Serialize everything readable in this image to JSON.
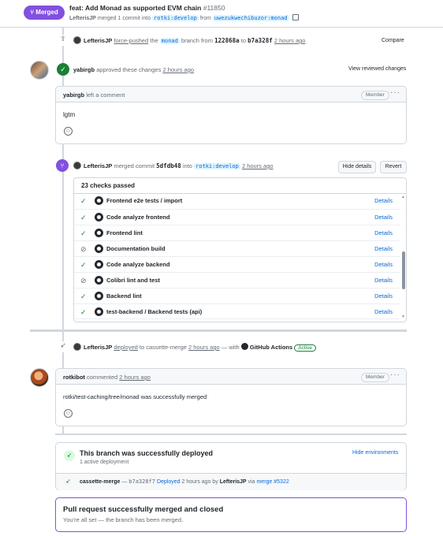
{
  "header": {
    "merged_badge": "Merged",
    "title": "feat: Add Monad as supported EVM chain",
    "number": "#11850",
    "author": "LefterisJP",
    "merge_text": "merged 1 commit into",
    "base_branch": "rotki:develop",
    "from_text": "from",
    "head_branch": "uwezukwechibuzor:monad"
  },
  "force_push": {
    "author": "LefterisJP",
    "action": "force-pushed",
    "the": "the",
    "branch": "monad",
    "branch_from": "branch from",
    "from_sha": "122868a",
    "to": "to",
    "to_sha": "b7a328f",
    "time": "2 hours ago",
    "compare": "Compare"
  },
  "approval": {
    "user": "yabirgb",
    "text": "approved these changes",
    "time": "2 hours ago",
    "view_changes": "View reviewed changes"
  },
  "comment1": {
    "user": "yabirgb",
    "action": "left a comment",
    "role": "Member",
    "body": "lgtm",
    "menu": "···"
  },
  "merge_event": {
    "author": "LefterisJP",
    "text": "merged commit",
    "sha": "5dfdb48",
    "into": "into",
    "branch": "rotki:develop",
    "time": "2 hours ago",
    "hide_details": "Hide details",
    "revert": "Revert"
  },
  "checks": {
    "summary": "23 checks passed",
    "details_label": "Details",
    "items": [
      {
        "name": "Frontend e2e tests / import",
        "status": "success"
      },
      {
        "name": "Code analyze frontend",
        "status": "success"
      },
      {
        "name": "Frontend lint",
        "status": "success"
      },
      {
        "name": "Documentation build",
        "status": "skipped"
      },
      {
        "name": "Code analyze backend",
        "status": "success"
      },
      {
        "name": "Colibri lint and test",
        "status": "skipped"
      },
      {
        "name": "Backend lint",
        "status": "success"
      },
      {
        "name": "test-backend / Backend tests (api)",
        "status": "success"
      }
    ]
  },
  "deploy_event": {
    "author": "LefterisJP",
    "action": "deployed",
    "to_text": "to cassette-merge",
    "time": "2 hours ago",
    "with_text": "— with",
    "app": "GitHub Actions",
    "state": "Active"
  },
  "comment2": {
    "user": "rotkibot",
    "action": "commented",
    "time": "2 hours ago",
    "role": "Member",
    "body": "rotki/test-caching/tree/monad was successfully merged",
    "menu": "···"
  },
  "deployment": {
    "title": "This branch was successfully deployed",
    "subtitle": "1 active deployment",
    "hide_env": "Hide environments",
    "env_name": "cassette-merge",
    "dash": "—",
    "sha": "b7a328f7",
    "deployed": "Deployed",
    "time_by": "2 hours ago by",
    "author": "LefterisJP",
    "via": "via",
    "merge_link": "merge",
    "merge_num": "#5322"
  },
  "merged_box": {
    "title": "Pull request successfully merged and closed",
    "subtitle": "You're all set — the branch has been merged."
  },
  "colors": {
    "merged_purple": "#8250df",
    "success_green": "#1a7f37",
    "link_blue": "#0969da",
    "border": "#d0d7de"
  }
}
